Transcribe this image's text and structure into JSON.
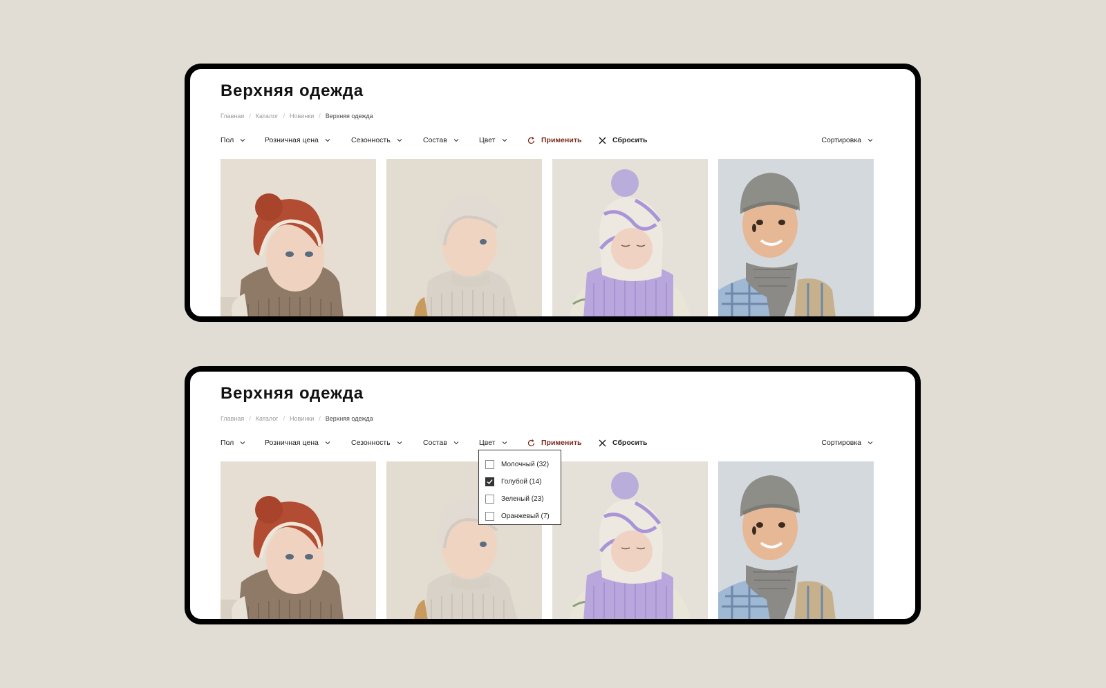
{
  "page_title": "Верхняя одежда",
  "breadcrumb": [
    "Главная",
    "Каталог",
    "Новинки",
    "Верхняя одежда"
  ],
  "filters": {
    "gender": "Пол",
    "price": "Розничная цена",
    "season": "Сезонность",
    "composition": "Состав",
    "color": "Цвет"
  },
  "apply_label": "Применить",
  "reset_label": "Сбросить",
  "sort_label": "Сортировка",
  "color_dropdown": [
    {
      "label": "Молочный (32)",
      "checked": false
    },
    {
      "label": "Голубой (14)",
      "checked": true
    },
    {
      "label": "Зеленый (23)",
      "checked": false
    },
    {
      "label": "Оранжевый (7)",
      "checked": false
    }
  ],
  "colors": {
    "background": "#e1ddd5",
    "frame": "#000000",
    "apply_accent": "#7a2b1e"
  },
  "icons": {
    "chevron": "chevron-down-icon",
    "apply": "refresh-icon",
    "reset": "close-icon",
    "checkbox_checked": "checkmark-icon"
  }
}
